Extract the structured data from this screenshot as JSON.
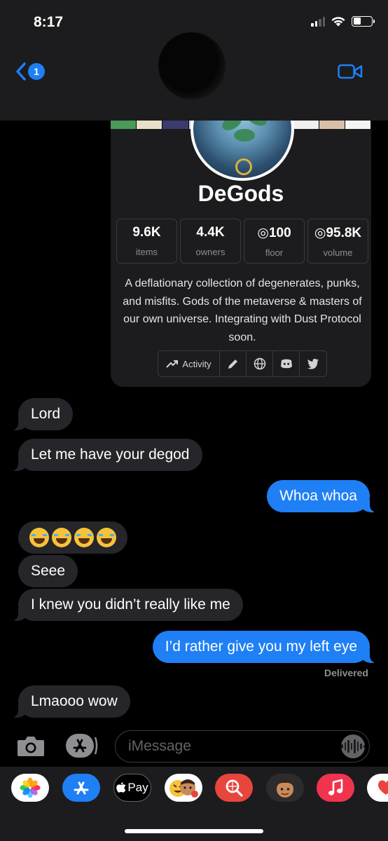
{
  "status_bar": {
    "time": "8:17"
  },
  "nav": {
    "back_count": "1"
  },
  "card": {
    "title": "DeGods",
    "stats": [
      {
        "value": "9.6K",
        "label": "items"
      },
      {
        "value": "4.4K",
        "label": "owners"
      },
      {
        "value": "◎100",
        "label": "floor"
      },
      {
        "value": "◎95.8K",
        "label": "volume"
      }
    ],
    "description": "A deflationary collection of degenerates, punks, and misfits. Gods of the metaverse & masters of our own universe. Integrating with Dust Protocol soon.",
    "activity_label": "Activity",
    "thumb_colors": [
      "#4a9a5a",
      "#e8e0c8",
      "#3b3b6e",
      "#c8d8e8",
      "#2e2e2e",
      "#8ab0d0",
      "#e0d8c0",
      "#f0f0f0",
      "#d8c0a8",
      "#f4f4f4"
    ]
  },
  "messages": [
    {
      "direction": "in",
      "text": "Lord"
    },
    {
      "direction": "in",
      "text": "Let me have your degod"
    },
    {
      "direction": "out",
      "text": "Whoa whoa"
    },
    {
      "direction": "in",
      "emoji": "face-with-tears-of-joy",
      "count": 4
    },
    {
      "direction": "in",
      "text": "Seee"
    },
    {
      "direction": "in",
      "text": "I knew you didn’t really like me"
    },
    {
      "direction": "out",
      "text": "I’d rather give you my left eye"
    },
    {
      "direction": "in",
      "text": "Lmaooo wow"
    }
  ],
  "delivered_label": "Delivered",
  "input": {
    "placeholder": "iMessage"
  },
  "drawer": {
    "apple_pay_label": "Pay",
    "apps": [
      "photos-app",
      "app-store-app",
      "apple-pay-app",
      "memoji-stickers-app",
      "web-images-app",
      "memoji-app",
      "music-app",
      "heart-app"
    ]
  },
  "colors": {
    "accent": "#1f7ff5",
    "incoming_bubble": "#26252a",
    "background": "#000000"
  }
}
